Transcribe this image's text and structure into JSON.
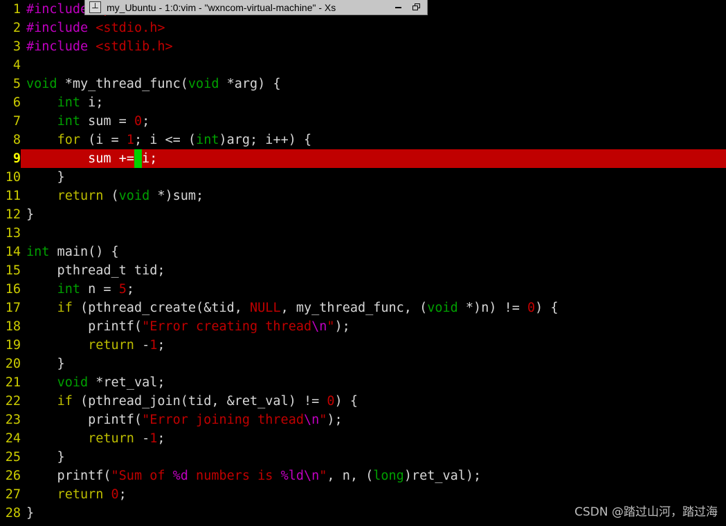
{
  "window": {
    "titlebar": {
      "icon": "vim-window-icon",
      "title": "my_Ubuntu - 1:0:vim - \"wxncom-virtual-machine\"  - Xs",
      "buttons": [
        {
          "name": "minimize-button",
          "glyph": "minimize-icon"
        },
        {
          "name": "restore-button",
          "glyph": "restore-icon"
        }
      ]
    }
  },
  "editor": {
    "app": "vim",
    "background": "#000000",
    "cursor_line": 9,
    "cursor_line_bg": "#c00000",
    "cursor_block_color": "#00d000",
    "line_number_color": "#cdcd00",
    "lines": [
      {
        "n": "1",
        "text": "#include <pthread.h>"
      },
      {
        "n": "2",
        "text": "#include <stdio.h>"
      },
      {
        "n": "3",
        "text": "#include <stdlib.h>"
      },
      {
        "n": "4",
        "text": ""
      },
      {
        "n": "5",
        "text": "void *my_thread_func(void *arg) {"
      },
      {
        "n": "6",
        "text": "    int i;"
      },
      {
        "n": "7",
        "text": "    int sum = 0;"
      },
      {
        "n": "8",
        "text": "    for (i = 1; i <= (int)arg; i++) {"
      },
      {
        "n": "9",
        "text": "        sum += i;"
      },
      {
        "n": "10",
        "text": "    }"
      },
      {
        "n": "11",
        "text": "    return (void *)sum;"
      },
      {
        "n": "12",
        "text": "}"
      },
      {
        "n": "13",
        "text": ""
      },
      {
        "n": "14",
        "text": "int main() {"
      },
      {
        "n": "15",
        "text": "    pthread_t tid;"
      },
      {
        "n": "16",
        "text": "    int n = 5;"
      },
      {
        "n": "17",
        "text": "    if (pthread_create(&tid, NULL, my_thread_func, (void *)n) != 0) {"
      },
      {
        "n": "18",
        "text": "        printf(\"Error creating thread\\n\");"
      },
      {
        "n": "19",
        "text": "        return -1;"
      },
      {
        "n": "20",
        "text": "    }"
      },
      {
        "n": "21",
        "text": "    void *ret_val;"
      },
      {
        "n": "22",
        "text": "    if (pthread_join(tid, &ret_val) != 0) {"
      },
      {
        "n": "23",
        "text": "        printf(\"Error joining thread\\n\");"
      },
      {
        "n": "24",
        "text": "        return -1;"
      },
      {
        "n": "25",
        "text": "    }"
      },
      {
        "n": "26",
        "text": "    printf(\"Sum of %d numbers is %ld\\n\", n, (long)ret_val);"
      },
      {
        "n": "27",
        "text": "    return 0;"
      },
      {
        "n": "28",
        "text": "}"
      }
    ],
    "line_numbers": [
      "1",
      "2",
      "3",
      "4",
      "5",
      "6",
      "7",
      "8",
      "9",
      "10",
      "11",
      "12",
      "13",
      "14",
      "15",
      "16",
      "17",
      "18",
      "19",
      "20",
      "21",
      "22",
      "23",
      "24",
      "25",
      "26",
      "27",
      "28"
    ]
  },
  "watermark": {
    "text": "CSDN @踏过山河，踏过海"
  }
}
